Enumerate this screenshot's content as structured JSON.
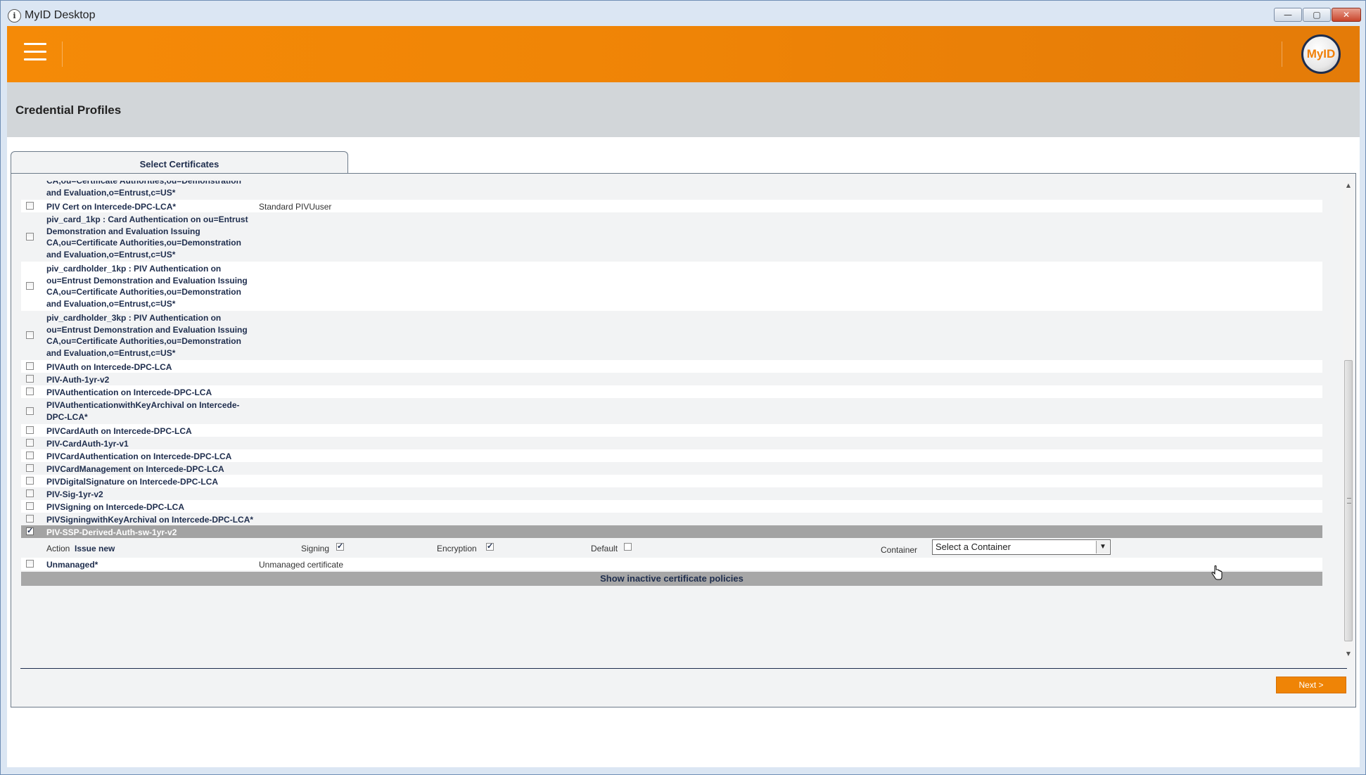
{
  "window": {
    "title": "MyID Desktop",
    "icon": "info-icon",
    "min_label": "—",
    "max_label": "▢",
    "close_label": "✕"
  },
  "header": {
    "menu_icon": "hamburger-icon",
    "logo_text": "MyID",
    "accent_color": "#f58a07"
  },
  "page": {
    "title": "Credential Profiles"
  },
  "tabs": [
    {
      "label": "Select Certificates",
      "active": true
    }
  ],
  "certificates": [
    {
      "name_lines": [
        "CA,ou=Certificate Authorities,ou=Demonstration",
        "and Evaluation,o=Entrust,c=US*"
      ],
      "desc": "",
      "checked": false,
      "partial": true
    },
    {
      "name_lines": [
        "PIV Cert on Intercede-DPC-LCA*"
      ],
      "desc": "Standard PIVUuser",
      "checked": false
    },
    {
      "name_lines": [
        "piv_card_1kp : Card Authentication on ou=Entrust",
        "Demonstration and Evaluation Issuing",
        "CA,ou=Certificate Authorities,ou=Demonstration",
        "and Evaluation,o=Entrust,c=US*"
      ],
      "desc": "",
      "checked": false
    },
    {
      "name_lines": [
        "piv_cardholder_1kp : PIV Authentication on",
        "ou=Entrust Demonstration and Evaluation Issuing",
        "CA,ou=Certificate Authorities,ou=Demonstration",
        "and Evaluation,o=Entrust,c=US*"
      ],
      "desc": "",
      "checked": false
    },
    {
      "name_lines": [
        "piv_cardholder_3kp : PIV Authentication on",
        "ou=Entrust Demonstration and Evaluation Issuing",
        "CA,ou=Certificate Authorities,ou=Demonstration",
        "and Evaluation,o=Entrust,c=US*"
      ],
      "desc": "",
      "checked": false
    },
    {
      "name_lines": [
        "PIVAuth on Intercede-DPC-LCA"
      ],
      "desc": "",
      "checked": false
    },
    {
      "name_lines": [
        "PIV-Auth-1yr-v2"
      ],
      "desc": "",
      "checked": false
    },
    {
      "name_lines": [
        "PIVAuthentication on Intercede-DPC-LCA"
      ],
      "desc": "",
      "checked": false
    },
    {
      "name_lines": [
        "PIVAuthenticationwithKeyArchival on Intercede-",
        "DPC-LCA*"
      ],
      "desc": "",
      "checked": false
    },
    {
      "name_lines": [
        "PIVCardAuth on Intercede-DPC-LCA"
      ],
      "desc": "",
      "checked": false
    },
    {
      "name_lines": [
        "PIV-CardAuth-1yr-v1"
      ],
      "desc": "",
      "checked": false
    },
    {
      "name_lines": [
        "PIVCardAuthentication on Intercede-DPC-LCA"
      ],
      "desc": "",
      "checked": false
    },
    {
      "name_lines": [
        "PIVCardManagement on Intercede-DPC-LCA"
      ],
      "desc": "",
      "checked": false
    },
    {
      "name_lines": [
        "PIVDigitalSignature on Intercede-DPC-LCA"
      ],
      "desc": "",
      "checked": false
    },
    {
      "name_lines": [
        "PIV-Sig-1yr-v2"
      ],
      "desc": "",
      "checked": false
    },
    {
      "name_lines": [
        "PIVSigning on Intercede-DPC-LCA"
      ],
      "desc": "",
      "checked": false
    },
    {
      "name_lines": [
        "PIVSigningwithKeyArchival on Intercede-DPC-LCA*"
      ],
      "desc": "",
      "checked": false
    },
    {
      "name_lines": [
        "PIV-SSP-Derived-Auth-sw-1yr-v2"
      ],
      "desc": "",
      "checked": true,
      "selected": true
    }
  ],
  "action_row": {
    "action_label": "Action",
    "action_value": "Issue new",
    "signing_label": "Signing",
    "signing_checked": true,
    "encryption_label": "Encryption",
    "encryption_checked": true,
    "default_label": "Default",
    "default_checked": false,
    "container_label": "Container",
    "container_value": "Select a Container"
  },
  "unmanaged": {
    "name": "Unmanaged*",
    "desc": "Unmanaged certificate",
    "checked": false
  },
  "show_inactive_label": "Show inactive certificate policies",
  "next_label": "Next >"
}
